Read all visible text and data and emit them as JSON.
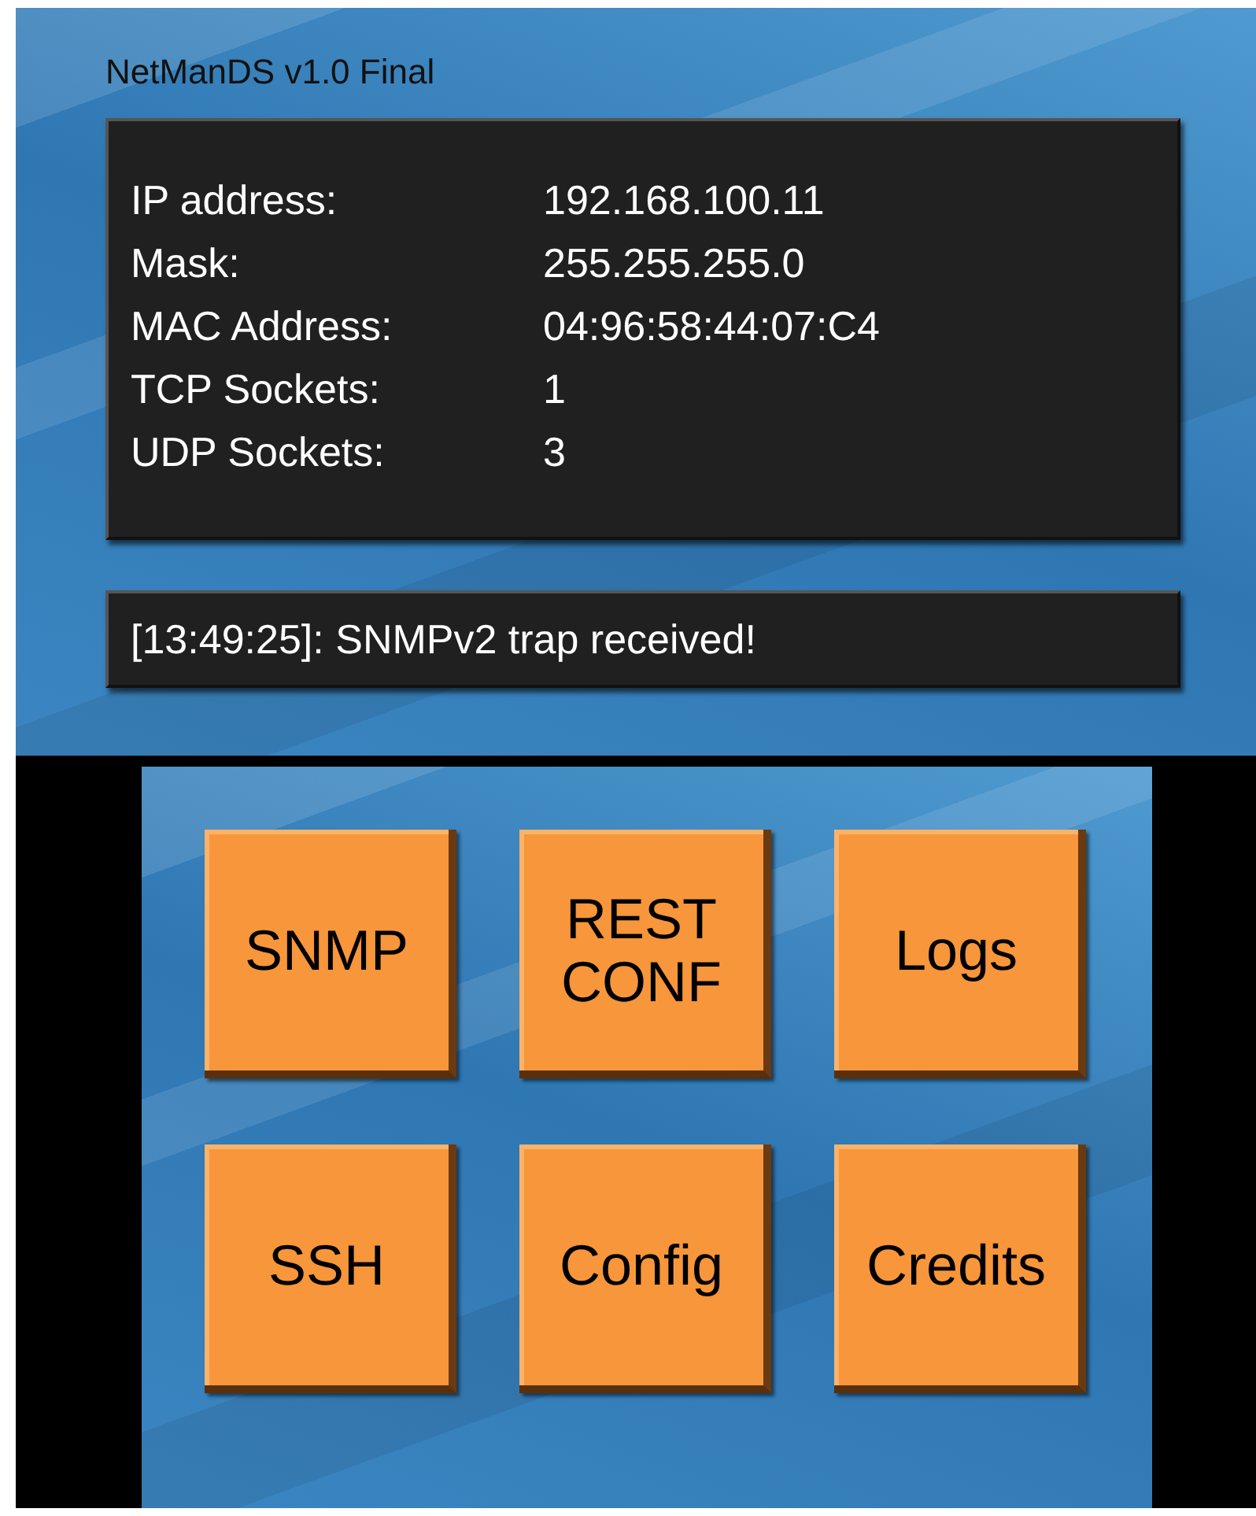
{
  "title": "NetManDS v1.0 Final",
  "info": [
    {
      "label": "IP address:",
      "value": "192.168.100.11"
    },
    {
      "label": "Mask:",
      "value": "255.255.255.0"
    },
    {
      "label": "MAC Address:",
      "value": "04:96:58:44:07:C4"
    },
    {
      "label": "TCP Sockets:",
      "value": "1"
    },
    {
      "label": "UDP Sockets:",
      "value": "3"
    }
  ],
  "status": "[13:49:25]: SNMPv2 trap received!",
  "buttons": [
    {
      "label": "SNMP"
    },
    {
      "label": "REST CONF"
    },
    {
      "label": "Logs"
    },
    {
      "label": "SSH"
    },
    {
      "label": "Config"
    },
    {
      "label": "Credits"
    }
  ]
}
